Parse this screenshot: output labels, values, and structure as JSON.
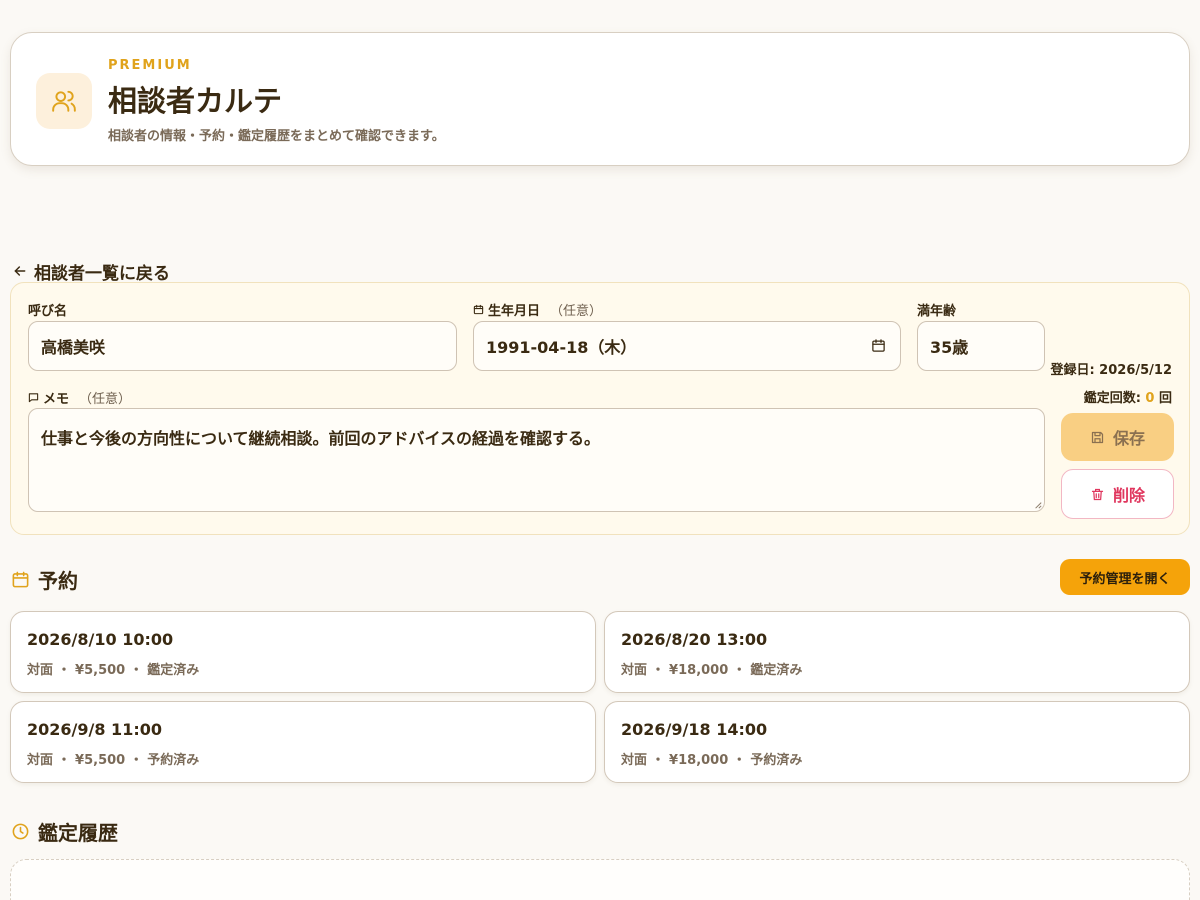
{
  "header": {
    "badge": "PREMIUM",
    "title": "相談者カルテ",
    "subtitle": "相談者の情報・予約・鑑定履歴をまとめて確認できます。",
    "icon": "users-icon"
  },
  "back_link": {
    "label": "相談者一覧に戻る",
    "icon": "arrow-left-icon"
  },
  "form": {
    "name": {
      "label": "呼び名",
      "value": "高橋美咲"
    },
    "birthdate": {
      "label": "生年月日",
      "optional": "（任意）",
      "value": "1991-04-18（木）",
      "icon": "calendar-icon"
    },
    "age": {
      "label": "満年齢",
      "value": "35歳"
    },
    "memo": {
      "label": "メモ",
      "optional": "（任意）",
      "value": "仕事と今後の方向性について継続相談。前回のアドバイスの経過を確認する。",
      "icon": "comment-icon"
    },
    "registered": "登録日: 2026/5/12",
    "reading_count_prefix": "鑑定回数: ",
    "reading_count": "0",
    "reading_count_suffix": " 回",
    "save_label": "保存",
    "delete_label": "削除"
  },
  "reservations": {
    "title": "予約",
    "manage_label": "予約管理を開く",
    "items": [
      {
        "date": "2026/8/10 10:00",
        "info": "対面 ・ ¥5,500 ・ 鑑定済み"
      },
      {
        "date": "2026/8/20 13:00",
        "info": "対面 ・ ¥18,000 ・ 鑑定済み"
      },
      {
        "date": "2026/9/8 11:00",
        "info": "対面 ・ ¥5,500 ・ 予約済み"
      },
      {
        "date": "2026/9/18 14:00",
        "info": "対面 ・ ¥18,000 ・ 予約済み"
      }
    ]
  },
  "history": {
    "title": "鑑定履歴",
    "icon": "clock-icon"
  },
  "colors": {
    "accent": "#f5a30a",
    "accent_text": "#e0a31c",
    "danger": "#e0365e",
    "background": "#fbf9f5"
  }
}
